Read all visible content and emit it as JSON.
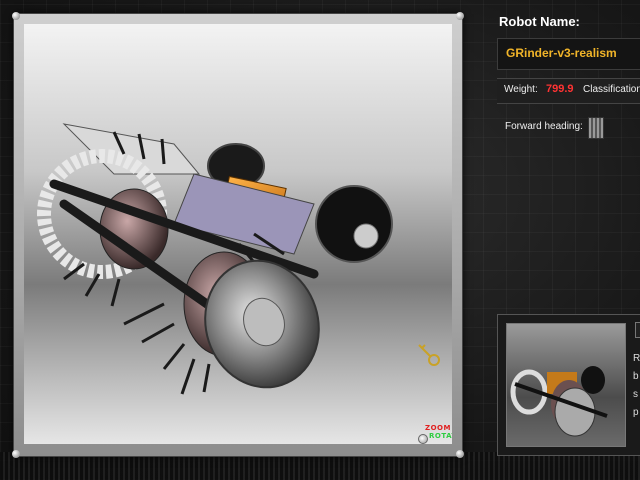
{
  "robot": {
    "name_label": "Robot Name:",
    "name_value": "GRinder-v3-realism"
  },
  "stats": {
    "weight_label": "Weight:",
    "weight_value": "799.9",
    "classification_label": "Classification"
  },
  "heading": {
    "label": "Forward heading:"
  },
  "viewport": {
    "zoom_label": "ZOOM",
    "rotate_label": "ROTATE"
  },
  "preview": {
    "lines": [
      "R",
      "b",
      "s",
      "p"
    ]
  },
  "icons": {
    "key": "key-icon",
    "heading_dial": "heading-dial-icon"
  },
  "colors": {
    "name_value": "#f0b429",
    "weight_value": "#ff3333",
    "zoom": "#e02020",
    "rotate": "#2ecc40"
  }
}
